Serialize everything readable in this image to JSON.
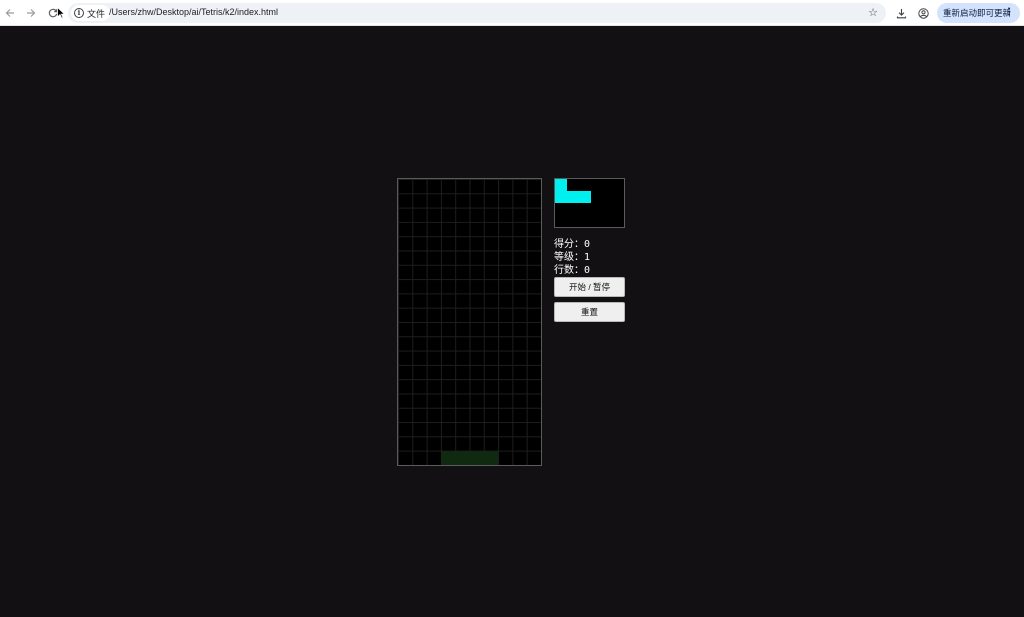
{
  "browser": {
    "site_chip_label": "文件",
    "url": "/Users/zhw/Desktop/ai/Tetris/k2/index.html",
    "update_label": "重新启动即可更新"
  },
  "game": {
    "board": {
      "columns": 10,
      "rows": 20
    },
    "next_piece": {
      "shape": "J",
      "color": "#00f0f0"
    },
    "ghost_color": "#0f2a10",
    "score_label": "得分：",
    "score_value": "0",
    "level_label": "等级：",
    "level_value": "1",
    "lines_label": "行数：",
    "lines_value": "0",
    "start_pause_label": "开始 / 暂停",
    "reset_label": "重置"
  }
}
